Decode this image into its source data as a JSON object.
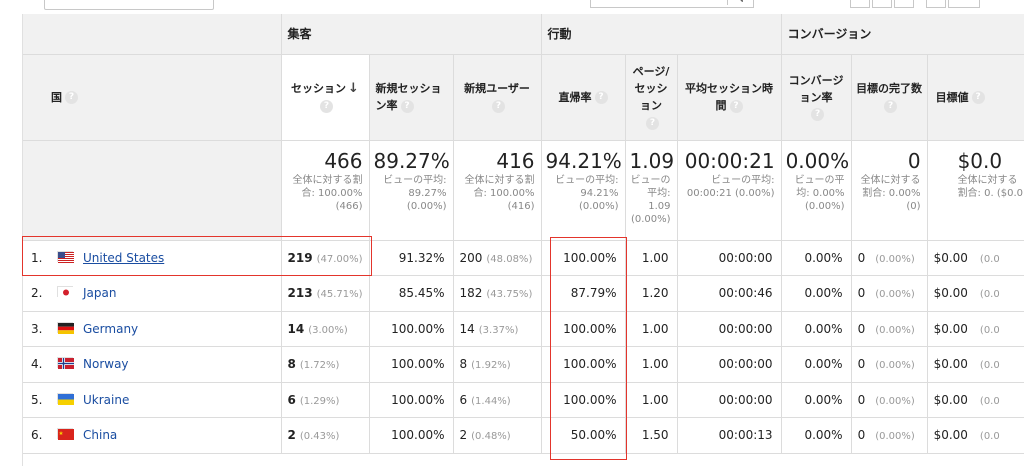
{
  "table": {
    "groups": {
      "acquisition": "集客",
      "behavior": "行動",
      "conversion": "コンバージョン"
    },
    "country_header": "国",
    "metrics": {
      "sessions": "セッション",
      "new_session_rate": "新規セッション率",
      "new_users": "新規ユーザー",
      "bounce_rate": "直帰率",
      "pages_per_session": "ページ/セッション",
      "avg_session_duration": "平均セッション時間",
      "conversion_rate": "コンバージョン率",
      "goal_completions": "目標の完了数",
      "goal_value": "目標値"
    },
    "totals": {
      "sessions": {
        "value": "466",
        "sub": "全体に対する割合: 100.00% (466)"
      },
      "new_session_rate": {
        "value": "89.27%",
        "sub": "ビューの平均: 89.27% (0.00%)"
      },
      "new_users": {
        "value": "416",
        "sub": "全体に対する割合: 100.00% (416)"
      },
      "bounce_rate": {
        "value": "94.21%",
        "sub": "ビューの平均: 94.21% (0.00%)"
      },
      "pages_per_session": {
        "value": "1.09",
        "sub": "ビューの平均: 1.09 (0.00%)"
      },
      "avg_session_duration": {
        "value": "00:00:21",
        "sub": "ビューの平均: 00:00:21 (0.00%)"
      },
      "conversion_rate": {
        "value": "0.00%",
        "sub": "ビューの平均: 0.00% (0.00%)"
      },
      "goal_completions": {
        "value": "0",
        "sub": "全体に対する割合: 0.00% (0)"
      },
      "goal_value": {
        "value": "$0.0",
        "sub": "全体に対する割合: 0. ($0.0"
      }
    },
    "rows": [
      {
        "rank": "1.",
        "country": "United States",
        "flag": "us",
        "sessions": "219",
        "sessions_pct": "(47.00%)",
        "new_session_rate": "91.32%",
        "new_users": "200",
        "new_users_pct": "(48.08%)",
        "bounce_rate": "100.00%",
        "pages": "1.00",
        "duration": "00:00:00",
        "conv_rate": "0.00%",
        "goals": "0",
        "goals_pct": "(0.00%)",
        "value": "$0.00",
        "value_pct": "(0.0"
      },
      {
        "rank": "2.",
        "country": "Japan",
        "flag": "jp",
        "sessions": "213",
        "sessions_pct": "(45.71%)",
        "new_session_rate": "85.45%",
        "new_users": "182",
        "new_users_pct": "(43.75%)",
        "bounce_rate": "87.79%",
        "pages": "1.20",
        "duration": "00:00:46",
        "conv_rate": "0.00%",
        "goals": "0",
        "goals_pct": "(0.00%)",
        "value": "$0.00",
        "value_pct": "(0.0"
      },
      {
        "rank": "3.",
        "country": "Germany",
        "flag": "de",
        "sessions": "14",
        "sessions_pct": "(3.00%)",
        "new_session_rate": "100.00%",
        "new_users": "14",
        "new_users_pct": "(3.37%)",
        "bounce_rate": "100.00%",
        "pages": "1.00",
        "duration": "00:00:00",
        "conv_rate": "0.00%",
        "goals": "0",
        "goals_pct": "(0.00%)",
        "value": "$0.00",
        "value_pct": "(0.0"
      },
      {
        "rank": "4.",
        "country": "Norway",
        "flag": "no",
        "sessions": "8",
        "sessions_pct": "(1.72%)",
        "new_session_rate": "100.00%",
        "new_users": "8",
        "new_users_pct": "(1.92%)",
        "bounce_rate": "100.00%",
        "pages": "1.00",
        "duration": "00:00:00",
        "conv_rate": "0.00%",
        "goals": "0",
        "goals_pct": "(0.00%)",
        "value": "$0.00",
        "value_pct": "(0.0"
      },
      {
        "rank": "5.",
        "country": "Ukraine",
        "flag": "ua",
        "sessions": "6",
        "sessions_pct": "(1.29%)",
        "new_session_rate": "100.00%",
        "new_users": "6",
        "new_users_pct": "(1.44%)",
        "bounce_rate": "100.00%",
        "pages": "1.00",
        "duration": "00:00:00",
        "conv_rate": "0.00%",
        "goals": "0",
        "goals_pct": "(0.00%)",
        "value": "$0.00",
        "value_pct": "(0.0"
      },
      {
        "rank": "6.",
        "country": "China",
        "flag": "cn",
        "sessions": "2",
        "sessions_pct": "(0.43%)",
        "new_session_rate": "100.00%",
        "new_users": "2",
        "new_users_pct": "(0.48%)",
        "bounce_rate": "50.00%",
        "pages": "1.50",
        "duration": "00:00:13",
        "conv_rate": "0.00%",
        "goals": "0",
        "goals_pct": "(0.00%)",
        "value": "$0.00",
        "value_pct": "(0.0"
      }
    ],
    "help_glyph": "?",
    "sort_glyph": "↓"
  },
  "colors": {
    "link": "#1a4da1",
    "highlight": "#e3352c",
    "header_bg": "#f1f1f1"
  }
}
